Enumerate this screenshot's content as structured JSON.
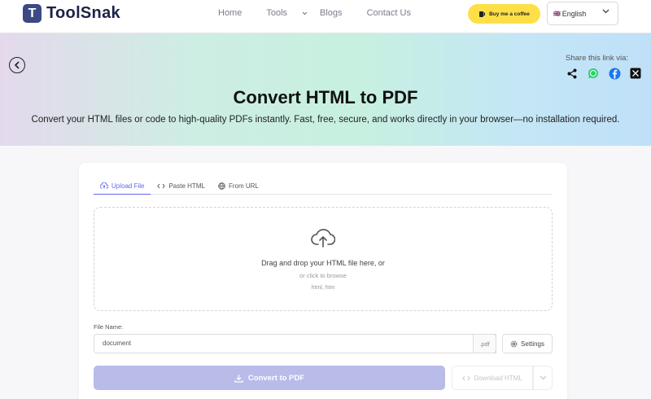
{
  "header": {
    "logo_letter": "T",
    "logo_text": "ToolSnak",
    "nav": [
      {
        "label": "Home"
      },
      {
        "label": "Tools"
      },
      {
        "label": "Blogs"
      },
      {
        "label": "Contact Us"
      }
    ],
    "coffee_label": "Buy me a coffee",
    "language": {
      "flag": "🇬🇧",
      "selected": "English"
    }
  },
  "hero": {
    "share_label": "Share this link via:",
    "share_icons": [
      "share-icon",
      "whatsapp-icon",
      "facebook-icon",
      "x-icon"
    ],
    "title": "Convert HTML to PDF",
    "subtitle": "Convert your HTML files or code to high-quality PDFs instantly. Fast, free, secure, and works directly in your browser—no installation required."
  },
  "tabs": [
    {
      "label": "Upload File",
      "icon": "cloud-upload-icon",
      "active": true
    },
    {
      "label": "Paste HTML",
      "icon": "code-icon",
      "active": false
    },
    {
      "label": "From URL",
      "icon": "globe-icon",
      "active": false
    }
  ],
  "dropzone": {
    "main_text": "Drag and drop your HTML file here, or",
    "alt_text": "or click to browse",
    "types": "html, htm"
  },
  "file_name": {
    "label": "File Name:",
    "value": "document",
    "extension": ".pdf"
  },
  "settings_label": "Settings",
  "convert_label": "Convert to PDF",
  "download_label": "Download HTML",
  "colors": {
    "accent": "#6366f1",
    "logo": "#3c4a84",
    "coffee": "#fde047",
    "convert_disabled": "#b9bbe9"
  }
}
